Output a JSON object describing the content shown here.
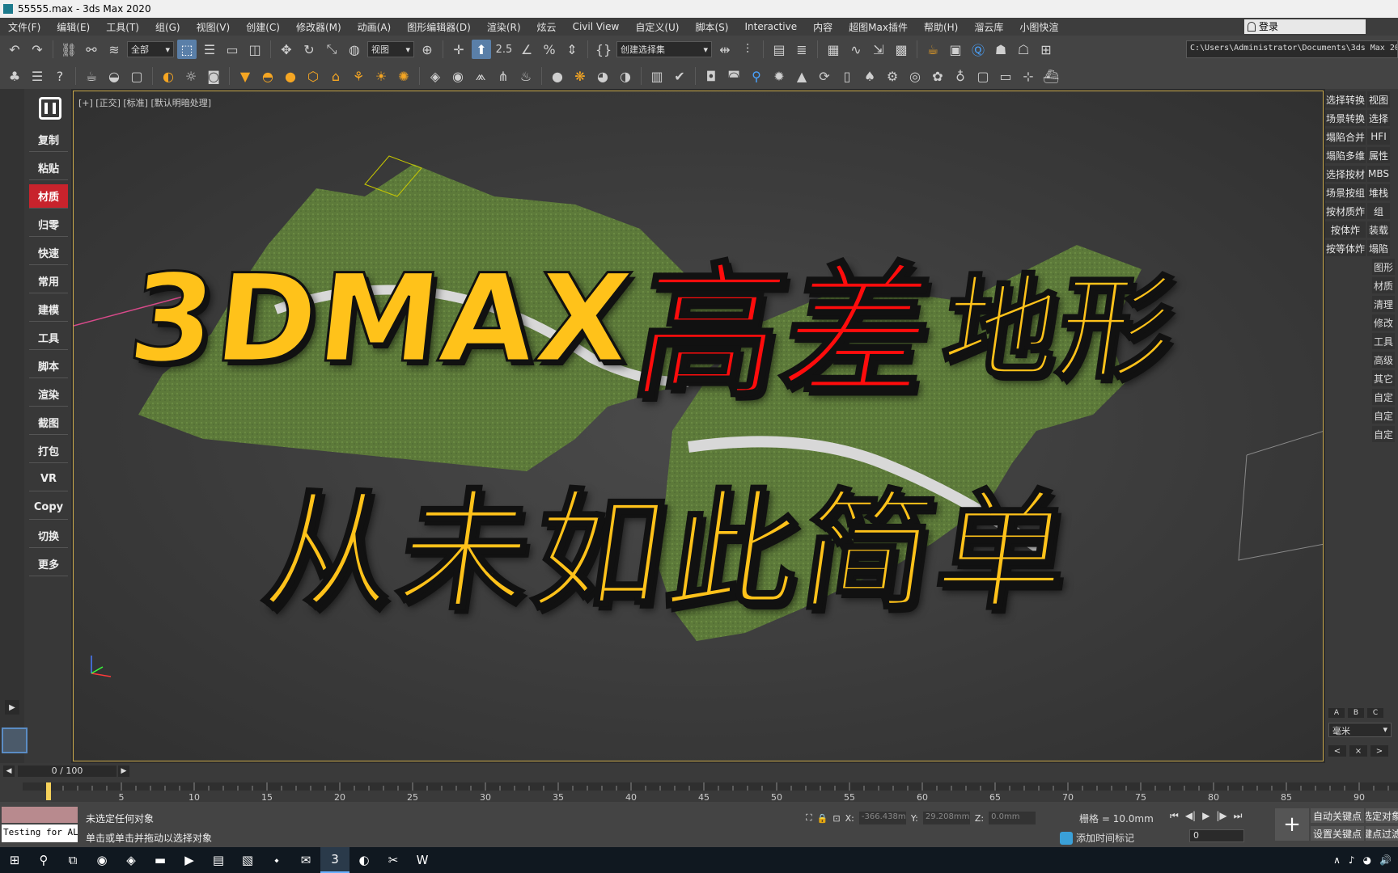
{
  "window": {
    "title": "55555.max - 3ds Max 2020"
  },
  "menu": [
    "文件(F)",
    "编辑(E)",
    "工具(T)",
    "组(G)",
    "视图(V)",
    "创建(C)",
    "修改器(M)",
    "动画(A)",
    "图形编辑器(D)",
    "渲染(R)",
    "炫云",
    "Civil View",
    "自定义(U)",
    "脚本(S)",
    "Interactive",
    "内容",
    "超图Max插件",
    "帮助(H)",
    "溜云库",
    "小图快渲"
  ],
  "login": "登录",
  "toolbar": {
    "selection_filter": "全部",
    "reference_coord": "视图",
    "named_selection": "创建选择集",
    "snap_value": "2.5",
    "path": "C:\\Users\\Administrator\\Documents\\3ds Max 2020"
  },
  "left_menu": [
    "复制",
    "粘贴",
    "材质",
    "归零",
    "快速",
    "常用",
    "建模",
    "工具",
    "脚本",
    "渲染",
    "截图",
    "打包",
    "VR",
    "Copy",
    "切换",
    "更多"
  ],
  "viewport": {
    "label": "[+] [正交] [标准] [默认明暗处理]",
    "headline_part1": "3DMAX",
    "headline_part2": "高差",
    "headline_part3": "地形",
    "headline_line2": "从未如此简单"
  },
  "right_panel": {
    "rows": [
      [
        "选择转换",
        "视图"
      ],
      [
        "场景转换",
        "选择"
      ],
      [
        "塌陷合并",
        "HFI"
      ],
      [
        "塌陷多维",
        "属性"
      ],
      [
        "选择按材",
        "MBS"
      ],
      [
        "场景按组",
        "堆栈"
      ],
      [
        "按材质炸",
        "组"
      ],
      [
        "按体炸",
        "装载"
      ],
      [
        "按等体炸",
        "塌陷"
      ]
    ],
    "singles": [
      "图形",
      "材质",
      "清理",
      "修改",
      "工具",
      "高级",
      "其它",
      "自定",
      "自定",
      "自定"
    ],
    "abc": [
      "A",
      "B",
      "C"
    ],
    "unit": "毫米",
    "nav": [
      "<",
      "×",
      ">"
    ]
  },
  "timeline": {
    "frame_display": "0 / 100",
    "ticks": [
      "5",
      "10",
      "15",
      "20",
      "25",
      "30",
      "35",
      "40",
      "45",
      "50",
      "55",
      "60",
      "65",
      "70",
      "75",
      "80",
      "85",
      "90"
    ]
  },
  "status": {
    "script_listener": "Testing for ALL",
    "msg1": "未选定任何对象",
    "msg2": "单击或单击并拖动以选择对象",
    "x_label": "X:",
    "x_value": "-366.438mm",
    "y_label": "Y:",
    "y_value": "29.208mm",
    "z_label": "Z:",
    "z_value": "0.0mm",
    "grid": "栅格 = 10.0mm",
    "add_time_tag": "添加时间标记",
    "frame": "0",
    "auto_key": "自动关键点",
    "set_key": "设置关键点",
    "selected": "选定对象",
    "key_filters": "关键点过滤器"
  },
  "colors": {
    "accent": "#ffc21a",
    "red": "#ff0c0c",
    "viewport_border": "#c8a84b",
    "highlight": "#c8232c"
  }
}
